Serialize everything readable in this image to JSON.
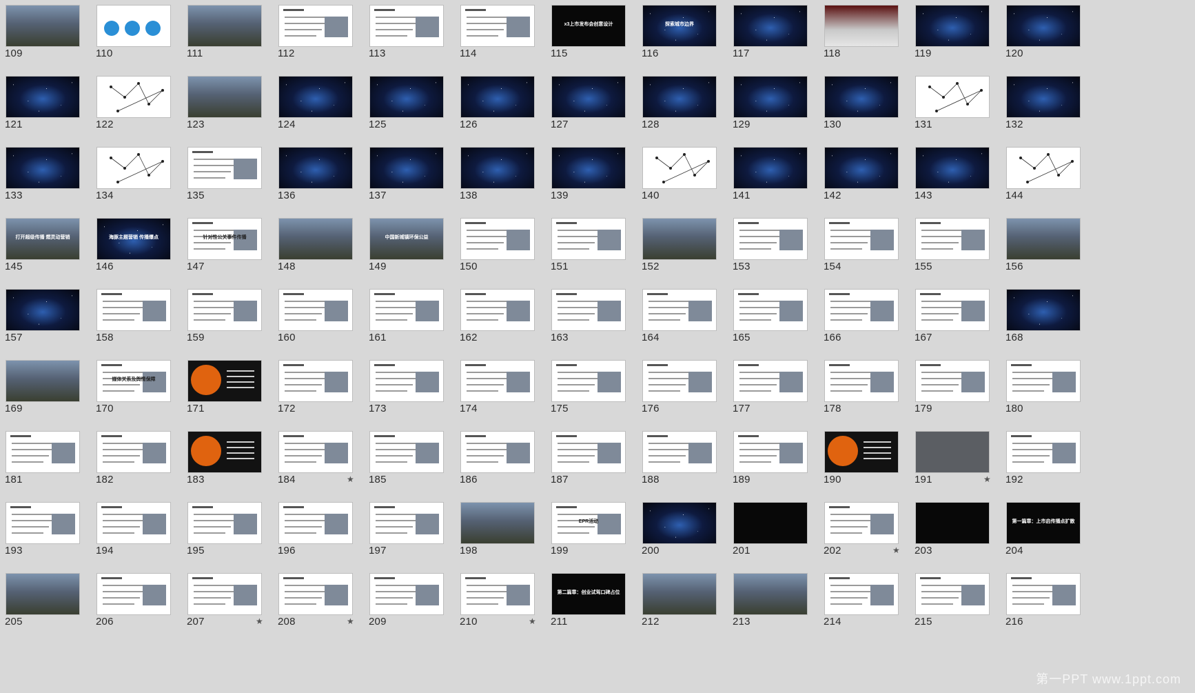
{
  "grid": {
    "start": 109,
    "columns": 12,
    "slides": [
      {
        "n": "109",
        "k": "photo"
      },
      {
        "n": "110",
        "k": "circles"
      },
      {
        "n": "111",
        "k": "photo"
      },
      {
        "n": "112",
        "k": "doc"
      },
      {
        "n": "113",
        "k": "doc"
      },
      {
        "n": "114",
        "k": "doc"
      },
      {
        "n": "115",
        "k": "black",
        "t": "x3上市发布会创意设计"
      },
      {
        "n": "116",
        "k": "space",
        "t": "探索城市边界"
      },
      {
        "n": "117",
        "k": "space"
      },
      {
        "n": "118",
        "k": "stage"
      },
      {
        "n": "119",
        "k": "space"
      },
      {
        "n": "120",
        "k": "space"
      },
      {
        "n": "121",
        "k": "space"
      },
      {
        "n": "122",
        "k": "web"
      },
      {
        "n": "123",
        "k": "photo"
      },
      {
        "n": "124",
        "k": "space"
      },
      {
        "n": "125",
        "k": "space"
      },
      {
        "n": "126",
        "k": "space"
      },
      {
        "n": "127",
        "k": "space"
      },
      {
        "n": "128",
        "k": "space"
      },
      {
        "n": "129",
        "k": "space"
      },
      {
        "n": "130",
        "k": "space"
      },
      {
        "n": "131",
        "k": "web"
      },
      {
        "n": "132",
        "k": "space"
      },
      {
        "n": "133",
        "k": "space"
      },
      {
        "n": "134",
        "k": "web"
      },
      {
        "n": "135",
        "k": "doc"
      },
      {
        "n": "136",
        "k": "space"
      },
      {
        "n": "137",
        "k": "space"
      },
      {
        "n": "138",
        "k": "space"
      },
      {
        "n": "139",
        "k": "space"
      },
      {
        "n": "140",
        "k": "web"
      },
      {
        "n": "141",
        "k": "space"
      },
      {
        "n": "142",
        "k": "space"
      },
      {
        "n": "143",
        "k": "space"
      },
      {
        "n": "144",
        "k": "web"
      },
      {
        "n": "145",
        "k": "photo",
        "t": "打开超级传播 燃灵动营销"
      },
      {
        "n": "146",
        "k": "space",
        "t": "海豚主题营销 传播爆点"
      },
      {
        "n": "147",
        "k": "doc",
        "t": "针对性公关事件传播"
      },
      {
        "n": "148",
        "k": "photo"
      },
      {
        "n": "149",
        "k": "photo",
        "t": "中国新城镇环保公益"
      },
      {
        "n": "150",
        "k": "doc"
      },
      {
        "n": "151",
        "k": "doc"
      },
      {
        "n": "152",
        "k": "photo"
      },
      {
        "n": "153",
        "k": "doc"
      },
      {
        "n": "154",
        "k": "doc"
      },
      {
        "n": "155",
        "k": "doc"
      },
      {
        "n": "156",
        "k": "photo"
      },
      {
        "n": "157",
        "k": "space"
      },
      {
        "n": "158",
        "k": "doc"
      },
      {
        "n": "159",
        "k": "doc"
      },
      {
        "n": "160",
        "k": "doc"
      },
      {
        "n": "161",
        "k": "doc"
      },
      {
        "n": "162",
        "k": "doc"
      },
      {
        "n": "163",
        "k": "doc"
      },
      {
        "n": "164",
        "k": "doc"
      },
      {
        "n": "165",
        "k": "doc"
      },
      {
        "n": "166",
        "k": "doc"
      },
      {
        "n": "167",
        "k": "doc"
      },
      {
        "n": "168",
        "k": "space"
      },
      {
        "n": "169",
        "k": "photo"
      },
      {
        "n": "170",
        "k": "doc",
        "t": "媒体关系及舆情保障"
      },
      {
        "n": "171",
        "k": "orange"
      },
      {
        "n": "172",
        "k": "doc"
      },
      {
        "n": "173",
        "k": "doc"
      },
      {
        "n": "174",
        "k": "doc"
      },
      {
        "n": "175",
        "k": "doc"
      },
      {
        "n": "176",
        "k": "doc"
      },
      {
        "n": "177",
        "k": "doc"
      },
      {
        "n": "178",
        "k": "doc"
      },
      {
        "n": "179",
        "k": "doc"
      },
      {
        "n": "180",
        "k": "doc"
      },
      {
        "n": "181",
        "k": "doc"
      },
      {
        "n": "182",
        "k": "doc"
      },
      {
        "n": "183",
        "k": "orange"
      },
      {
        "n": "184",
        "k": "doc",
        "s": "★"
      },
      {
        "n": "185",
        "k": "doc"
      },
      {
        "n": "186",
        "k": "doc"
      },
      {
        "n": "187",
        "k": "doc"
      },
      {
        "n": "188",
        "k": "doc"
      },
      {
        "n": "189",
        "k": "doc"
      },
      {
        "n": "190",
        "k": "orange"
      },
      {
        "n": "191",
        "k": "gray",
        "s": "★"
      },
      {
        "n": "192",
        "k": "doc"
      },
      {
        "n": "193",
        "k": "doc"
      },
      {
        "n": "194",
        "k": "doc"
      },
      {
        "n": "195",
        "k": "doc"
      },
      {
        "n": "196",
        "k": "doc"
      },
      {
        "n": "197",
        "k": "doc"
      },
      {
        "n": "198",
        "k": "photo"
      },
      {
        "n": "199",
        "k": "doc",
        "t": "EPR活动"
      },
      {
        "n": "200",
        "k": "space"
      },
      {
        "n": "201",
        "k": "black"
      },
      {
        "n": "202",
        "k": "doc",
        "s": "★"
      },
      {
        "n": "203",
        "k": "black"
      },
      {
        "n": "204",
        "k": "black",
        "t": "第一篇章：上市启传播点扩散"
      },
      {
        "n": "205",
        "k": "photo"
      },
      {
        "n": "206",
        "k": "doc"
      },
      {
        "n": "207",
        "k": "doc",
        "s": "★"
      },
      {
        "n": "208",
        "k": "doc",
        "s": "★"
      },
      {
        "n": "209",
        "k": "doc"
      },
      {
        "n": "210",
        "k": "doc",
        "s": "★"
      },
      {
        "n": "211",
        "k": "black",
        "t": "第二篇章：创业试驾口碑占位"
      },
      {
        "n": "212",
        "k": "photo"
      },
      {
        "n": "213",
        "k": "photo"
      },
      {
        "n": "214",
        "k": "doc"
      },
      {
        "n": "215",
        "k": "doc"
      },
      {
        "n": "216",
        "k": "doc"
      }
    ]
  },
  "watermark": "第一PPT www.1ppt.com",
  "colors": {
    "background": "#d8d8d8",
    "label": "#2b2b2b",
    "accent_orange": "#e0630f",
    "accent_blue": "#2a8fd6"
  }
}
